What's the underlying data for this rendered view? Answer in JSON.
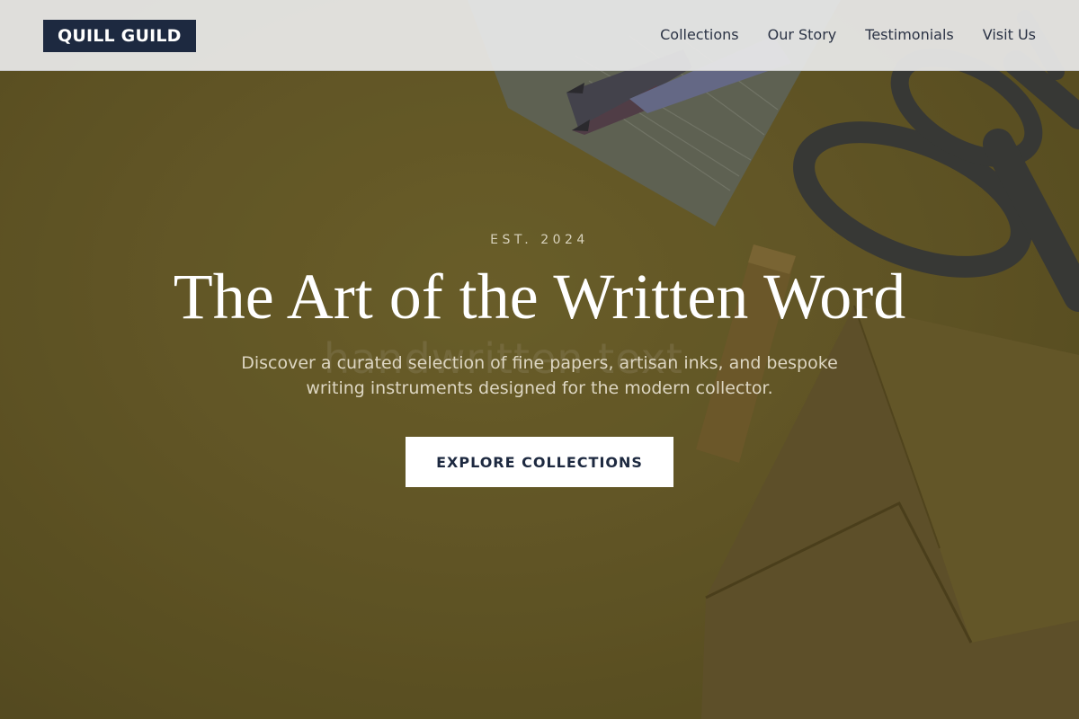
{
  "brand": {
    "logo_text": "QUILL GUILD"
  },
  "nav": {
    "links": [
      {
        "label": "Collections"
      },
      {
        "label": "Our Story"
      },
      {
        "label": "Testimonials"
      },
      {
        "label": "Visit Us"
      }
    ]
  },
  "hero": {
    "eyebrow": "EST. 2024",
    "headline": "The Art of the Written Word",
    "subtext": "Discover a curated selection of fine papers, artisan inks, and bespoke writing instruments designed for the modern collector.",
    "cta_label": "EXPLORE COLLECTIONS",
    "background_image": "stationery-flatlay-image"
  },
  "colors": {
    "brand_navy": "#1d2940",
    "hero_olive": "#6d602b",
    "navbar_bg": "#eaeaea",
    "cta_bg": "#ffffff"
  }
}
